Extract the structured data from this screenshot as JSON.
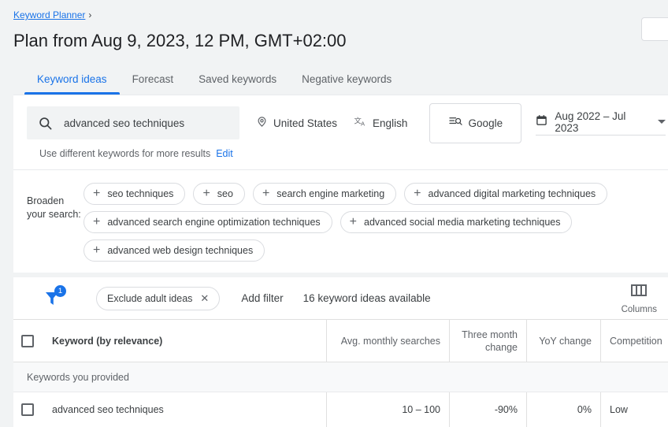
{
  "breadcrumb": {
    "link": "Keyword Planner",
    "chevron": "›"
  },
  "page_title": "Plan from Aug 9, 2023, 12 PM, GMT+02:00",
  "tabs": [
    {
      "label": "Keyword ideas",
      "active": true
    },
    {
      "label": "Forecast",
      "active": false
    },
    {
      "label": "Saved keywords",
      "active": false
    },
    {
      "label": "Negative keywords",
      "active": false
    }
  ],
  "search": {
    "value": "advanced seo techniques",
    "icon": "search-icon",
    "location": "United States",
    "location_icon": "location-pin-icon",
    "language": "English",
    "language_icon": "translate-icon",
    "network": "Google",
    "network_icon": "search-network-icon",
    "date_range": "Aug 2022 – Jul 2023",
    "date_icon": "calendar-icon"
  },
  "hint": {
    "text": "Use different keywords for more results",
    "edit": "Edit"
  },
  "broaden": {
    "label": "Broaden your search:",
    "chips": [
      "seo techniques",
      "seo",
      "search engine marketing",
      "advanced digital marketing techniques",
      "advanced search engine optimization techniques",
      "advanced social media marketing techniques",
      "advanced web design techniques"
    ],
    "plus": "+"
  },
  "toolbar": {
    "filter_icon": "filter-funnel-icon",
    "filter_badge": "1",
    "active_filter": "Exclude adult ideas",
    "remove_filter": "✕",
    "add_filter": "Add filter",
    "availability": "16 keyword ideas available",
    "columns_label": "Columns",
    "columns_icon": "columns-icon"
  },
  "table": {
    "headers": {
      "keyword": "Keyword (by relevance)",
      "avg_monthly_searches": "Avg. monthly searches",
      "three_month_change": "Three month change",
      "yoy_change": "YoY change",
      "competition": "Competition"
    },
    "section_label": "Keywords you provided",
    "rows": [
      {
        "keyword": "advanced seo techniques",
        "avg_monthly_searches": "10 – 100",
        "three_month_change": "-90%",
        "yoy_change": "0%",
        "competition": "Low"
      }
    ]
  },
  "colors": {
    "accent": "#1a73e8",
    "page_bg": "#f1f3f4",
    "text": "#3c4043",
    "muted": "#5f6368"
  }
}
